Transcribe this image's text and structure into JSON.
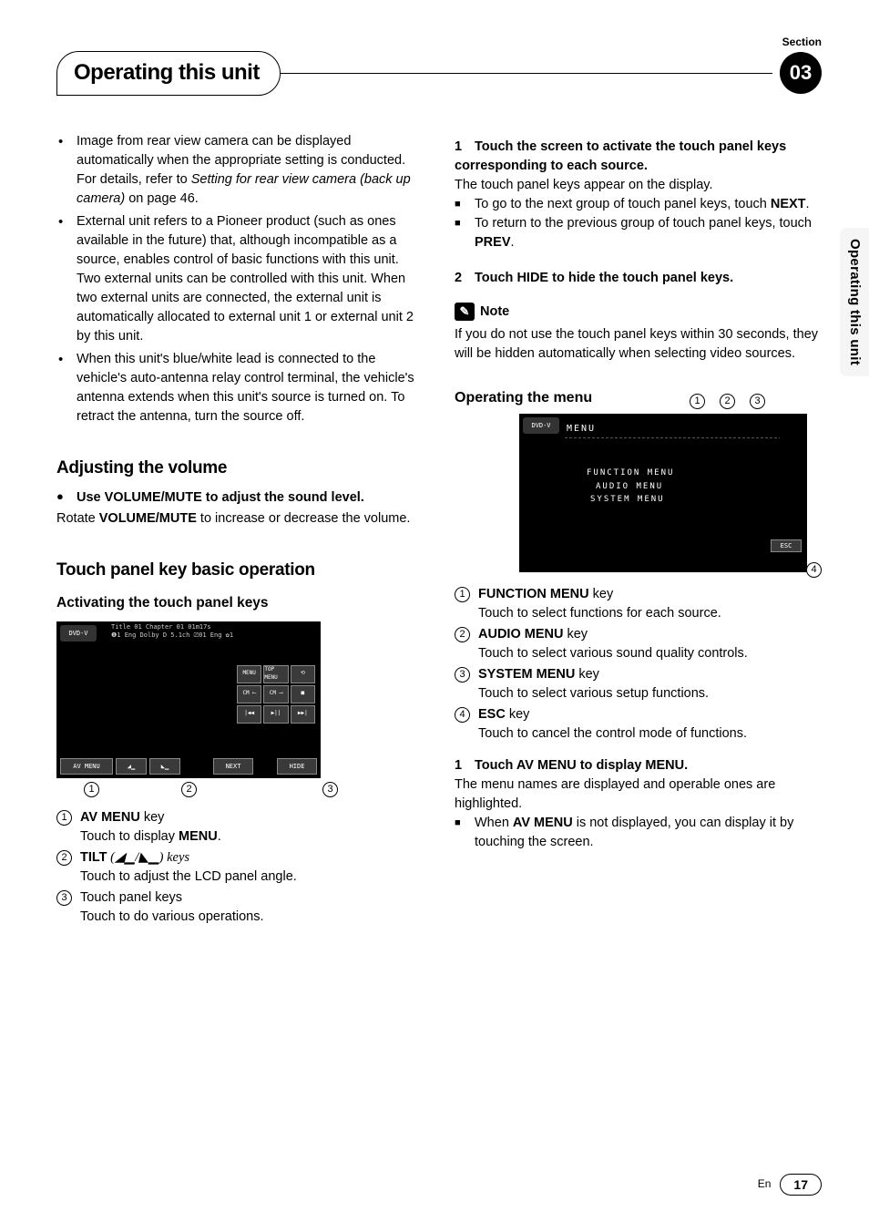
{
  "section_label": "Section",
  "section_number": "03",
  "header_title": "Operating this unit",
  "side_tab": "Operating this unit",
  "left": {
    "bullets": [
      {
        "pre": "Image from rear view camera can be displayed automatically when the appropriate setting is conducted. For details, refer to ",
        "em": "Setting for rear view camera (back up camera)",
        "post": " on page 46."
      },
      {
        "pre": "External unit refers to a Pioneer product (such as ones available in the future) that, although incompatible as a source, enables control of basic functions with this unit. Two external units can be controlled with this unit. When two external units are connected, the external unit is automatically allocated to external unit 1 or external unit 2 by this unit.",
        "em": "",
        "post": ""
      },
      {
        "pre": "When this unit's blue/white lead is connected to the vehicle's auto-antenna relay control terminal, the vehicle's antenna extends when this unit's source is turned on. To retract the antenna, turn the source off.",
        "em": "",
        "post": ""
      }
    ],
    "adjusting_heading": "Adjusting the volume",
    "adjusting_lead": "Use VOLUME/MUTE to adjust the sound level.",
    "adjusting_body_pre": "Rotate ",
    "adjusting_body_bold": "VOLUME/MUTE",
    "adjusting_body_post": " to increase or decrease the volume.",
    "touchpanel_heading": "Touch panel key basic operation",
    "touchpanel_sub": "Activating the touch panel keys",
    "screen1": {
      "source": "DVD-V",
      "info_line1": "Title 01   Chapter 01               01m17s",
      "info_line2": "❶1   Eng  Dolby D 5.1ch  ⎚01 Eng   ✿1",
      "buttons": [
        "MENU",
        "TOP MENU",
        "⟲",
        "CM ⟵",
        "CM ⟶",
        "■",
        "|◀◀",
        "▶||",
        "▶▶|"
      ],
      "bottom": {
        "avmenu": "AV MENU",
        "tilt1": "◢▁",
        "tilt2": "◣▁",
        "next": "NEXT",
        "hide": "HIDE"
      }
    },
    "callouts": [
      "1",
      "2",
      "3"
    ],
    "keylist": [
      {
        "n": "1",
        "title": "AV MENU",
        "suffix": " key",
        "desc_pre": "Touch to display ",
        "desc_bold": "MENU",
        "desc_post": "."
      },
      {
        "n": "2",
        "title": "TILT",
        "suffix": " (◢▁/◣▁) keys",
        "desc_pre": "Touch to adjust the LCD panel angle.",
        "desc_bold": "",
        "desc_post": ""
      },
      {
        "n": "3",
        "title": "",
        "suffix": "Touch panel keys",
        "desc_pre": "Touch to do various operations.",
        "desc_bold": "",
        "desc_post": ""
      }
    ]
  },
  "right": {
    "step1_num": "1",
    "step1_text": "Touch the screen to activate the touch panel keys corresponding to each source.",
    "step1_para": "The touch panel keys appear on the display.",
    "step1_sq1_pre": "To go to the next group of touch panel keys, touch ",
    "step1_sq1_bold": "NEXT",
    "step1_sq1_post": ".",
    "step1_sq2_pre": "To return to the previous group of touch panel keys, touch ",
    "step1_sq2_bold": "PREV",
    "step1_sq2_post": ".",
    "step2_num": "2",
    "step2_text": "Touch HIDE to hide the touch panel keys.",
    "note_label": "Note",
    "note_body": "If you do not use the touch panel keys within 30 seconds, they will be hidden automatically when selecting video sources.",
    "op_menu_heading": "Operating the menu",
    "screen2": {
      "source": "DVD-V",
      "title": "MENU",
      "items": [
        "FUNCTION MENU",
        "AUDIO MENU",
        "SYSTEM MENU"
      ],
      "esc": "ESC"
    },
    "callouts_top": [
      "1",
      "2",
      "3"
    ],
    "callout_bot": "4",
    "keylist": [
      {
        "n": "1",
        "title": "FUNCTION MENU",
        "suffix": " key",
        "desc": "Touch to select functions for each source."
      },
      {
        "n": "2",
        "title": "AUDIO MENU",
        "suffix": " key",
        "desc": "Touch to select various sound quality controls."
      },
      {
        "n": "3",
        "title": "SYSTEM MENU",
        "suffix": " key",
        "desc": "Touch to select various setup functions."
      },
      {
        "n": "4",
        "title": "ESC",
        "suffix": " key",
        "desc": "Touch to cancel the control mode of functions."
      }
    ],
    "step3_num": "1",
    "step3_text": "Touch AV MENU to display MENU.",
    "step3_para": "The menu names are displayed and operable ones are highlighted.",
    "step3_sq_pre": "When ",
    "step3_sq_bold": "AV MENU",
    "step3_sq_post": " is not displayed, you can display it by touching the screen."
  },
  "footer": {
    "lang": "En",
    "page": "17"
  }
}
